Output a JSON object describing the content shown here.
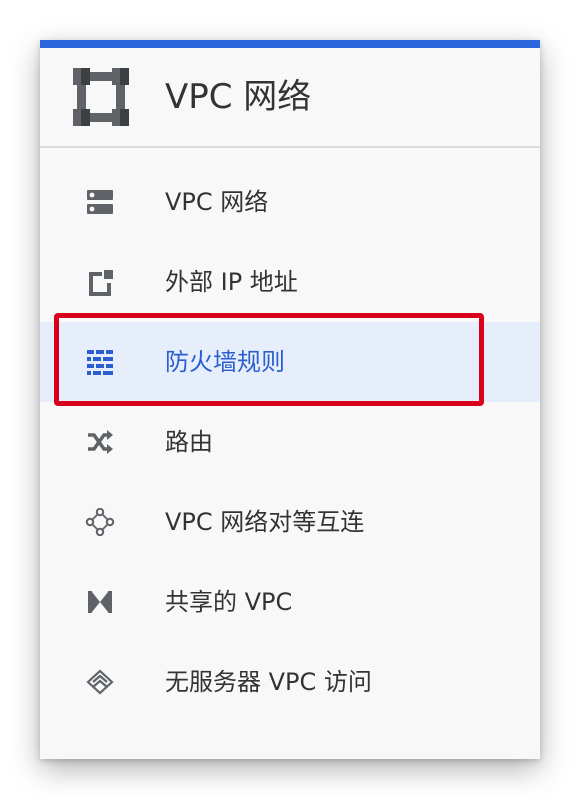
{
  "header": {
    "title": "VPC 网络",
    "icon": "vpc-network-logo-icon"
  },
  "nav": {
    "items": [
      {
        "label": "VPC 网络",
        "icon": "vpc-network-icon",
        "active": false
      },
      {
        "label": "外部 IP 地址",
        "icon": "external-ip-icon",
        "active": false
      },
      {
        "label": "防火墙规则",
        "icon": "firewall-icon",
        "active": true
      },
      {
        "label": "路由",
        "icon": "routes-icon",
        "active": false
      },
      {
        "label": "VPC 网络对等互连",
        "icon": "vpc-peering-icon",
        "active": false
      },
      {
        "label": "共享的 VPC",
        "icon": "shared-vpc-icon",
        "active": false
      },
      {
        "label": "无服务器 VPC 访问",
        "icon": "serverless-vpc-access-icon",
        "active": false
      }
    ]
  },
  "colors": {
    "accent": "#2d67de",
    "active_bg": "#e6eefb",
    "active_text": "#2b5fcf",
    "annotation": "#d9001b"
  }
}
